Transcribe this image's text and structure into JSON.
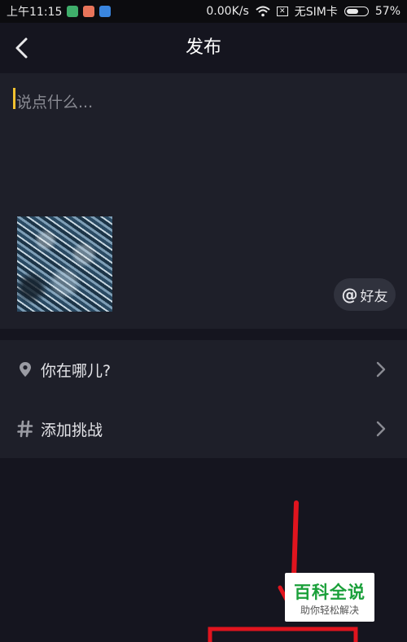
{
  "status_bar": {
    "time": "上午11:15",
    "network_speed": "0.00K/s",
    "sim_status": "无SIM卡",
    "battery_percent": "57%",
    "battery_level": 0.57,
    "app_icon_colors": [
      "#3fae6b",
      "#e8745a",
      "#3a86e0"
    ]
  },
  "header": {
    "title": "发布",
    "back_icon": "chevron-left-icon"
  },
  "compose": {
    "caption_value": "",
    "caption_placeholder": "说点什么...",
    "cursor_color": "#f2c230",
    "mention_button": {
      "symbol": "@",
      "label": "好友"
    }
  },
  "options": [
    {
      "icon": "location-pin-icon",
      "label": "你在哪儿?"
    },
    {
      "icon": "hashtag-icon",
      "label": "添加挑战"
    }
  ],
  "annotation": {
    "color": "#e0141e"
  },
  "watermark": {
    "title": "百科全说",
    "subtitle": "助你轻松解决",
    "title_color": "#1aa03a"
  }
}
